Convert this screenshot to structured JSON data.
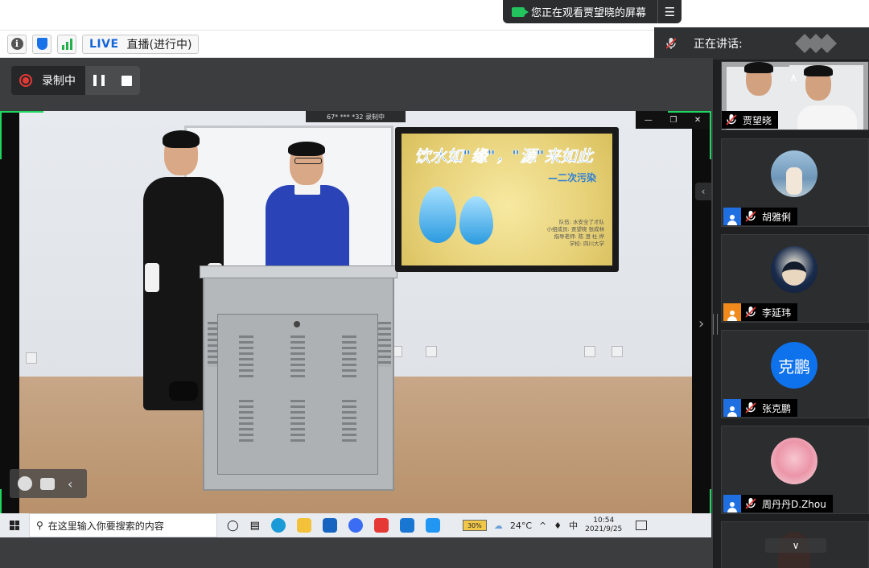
{
  "share_banner": {
    "text": "您正在观看贾望晓的屏幕"
  },
  "info_bar": {
    "live_tag": "LIVE",
    "live_status": "直播(进行中)"
  },
  "speaking": {
    "label": "正在讲话:"
  },
  "recording": {
    "label": "录制中"
  },
  "shared_screen": {
    "mini_bar": "67* *** *32  录制中",
    "tv_title": "饮水如\"缘\"，\"源\"来如此",
    "tv_subtitle": "—二次污染",
    "tv_info": [
      "队伍: 水安全了才队",
      "小组成员: 贾望晓 张成林",
      "指导老师: 陈 澄 杜 烨",
      "学校: 四川大学"
    ]
  },
  "taskbar": {
    "search_placeholder": "在这里输入你要搜索的内容",
    "battery": "30%",
    "weather": "24°C",
    "ime": "中",
    "time": "10:54",
    "date": "2021/9/25"
  },
  "participants": [
    {
      "name": "贾望晓",
      "tile": "video"
    },
    {
      "name": "胡雅俐",
      "tile": "photo"
    },
    {
      "name": "李延玮",
      "tile": "photo"
    },
    {
      "name": "张克鹏",
      "tile": "initials",
      "initials": "克鹏"
    },
    {
      "name": "周丹丹D.Zhou",
      "tile": "photo"
    }
  ],
  "colors": {
    "accent_green": "#1ed760",
    "brand_blue": "#0e72ed",
    "record_red": "#e53935",
    "mic_red": "#e53935"
  }
}
